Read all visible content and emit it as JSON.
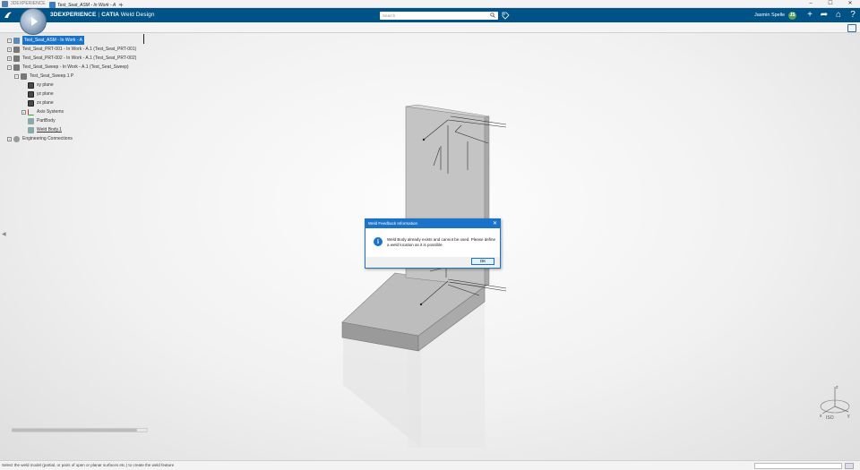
{
  "window": {
    "title": "3DEXPERIENCE",
    "controls": [
      "–",
      "☐",
      "✕"
    ]
  },
  "topbar": {
    "brand": "3DEXPERIENCE",
    "separator": "|",
    "app_prefix": "CATIA",
    "app_name": "Weld Design",
    "search_placeholder": "Search",
    "user_name": "Jasmin Spelle",
    "avatar_initials": "JS",
    "icons": [
      "plus-icon",
      "share-icon",
      "home-icon",
      "help-icon"
    ]
  },
  "tab": {
    "label": "Test_Seat_ASM - In Work - A",
    "close": "×",
    "add": "+"
  },
  "tree": {
    "items": [
      {
        "label": "Test_Seat_ASM - In Work - A",
        "icon": "assembly-icon",
        "indent": 0,
        "expander": "−",
        "selected": true
      },
      {
        "label": "Test_Seat_PRT-001 - In Work - A.1 (Test_Seat_PRT-001)",
        "icon": "part-icon",
        "indent": 0,
        "expander": "+",
        "selected": false
      },
      {
        "label": "Test_Seat_PRT-002 - In Work - A.1 (Test_Seat_PRT-002)",
        "icon": "part-icon",
        "indent": 0,
        "expander": "+",
        "selected": false
      },
      {
        "label": "Test_Seat_Sweep - In Work - A.1 (Test_Seat_Sweep)",
        "icon": "part-icon",
        "indent": 0,
        "expander": "−",
        "selected": false
      },
      {
        "label": "Test_Seat_Sweep.1 P",
        "icon": "part-icon",
        "indent": 1,
        "expander": "−",
        "selected": false
      },
      {
        "label": "xy plane",
        "icon": "plane-icon",
        "indent": 2,
        "expander": "",
        "selected": false
      },
      {
        "label": "yz plane",
        "icon": "plane-icon",
        "indent": 2,
        "expander": "",
        "selected": false
      },
      {
        "label": "zx plane",
        "icon": "plane-icon",
        "indent": 2,
        "expander": "",
        "selected": false
      },
      {
        "label": "Axis Systems",
        "icon": "axis-icon",
        "indent": 2,
        "expander": "+",
        "selected": false
      },
      {
        "label": "PartBody",
        "icon": "body-icon",
        "indent": 2,
        "expander": "",
        "selected": false
      },
      {
        "label": "Weld Body.1",
        "icon": "body-icon",
        "indent": 2,
        "expander": "",
        "selected": false,
        "underline": true
      },
      {
        "label": "Engineering Connections",
        "icon": "connection-icon",
        "indent": 0,
        "expander": "+",
        "selected": false
      }
    ]
  },
  "dialog": {
    "title": "Weld Feedback Information",
    "close": "✕",
    "message": "Weld Body already exists and cannot be used. Please define a weld location as it is possible.",
    "ok_label": "OK"
  },
  "triad": {
    "x_label": "x",
    "y_label": "y",
    "z_label": "z",
    "view_label": "ISO"
  },
  "statusbar": {
    "text": "Select the weld model (partial, or pairs of open or planar surfaces etc.) to create the weld feature"
  },
  "colors": {
    "topbar": "#005386",
    "accent": "#1a73c8",
    "model_face": "#c4c4c4"
  }
}
